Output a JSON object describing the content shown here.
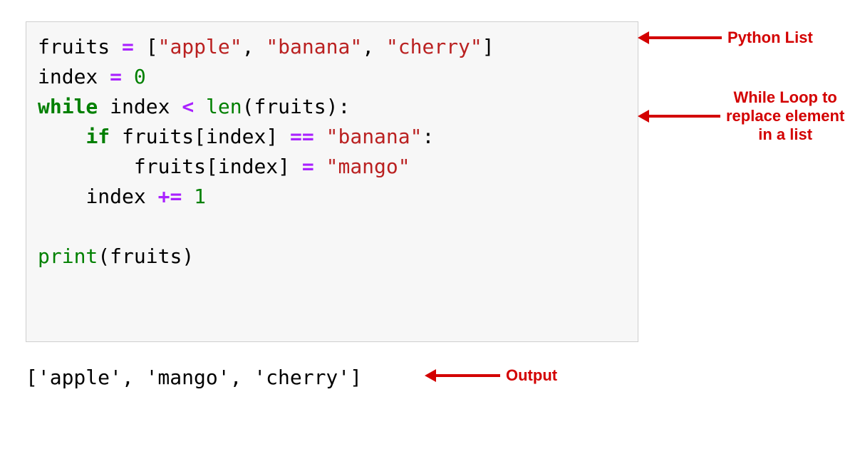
{
  "code": {
    "line1": {
      "var_fruits": "fruits",
      "assign": " = ",
      "lbracket": "[",
      "str_apple": "\"apple\"",
      "comma1": ", ",
      "str_banana": "\"banana\"",
      "comma2": ", ",
      "str_cherry": "\"cherry\"",
      "rbracket": "]"
    },
    "line2": {
      "var_index": "index",
      "assign": " = ",
      "num_zero": "0"
    },
    "line3": {
      "kw_while": "while",
      "sp1": " ",
      "var_index": "index",
      "sp2": " ",
      "op_lt": "<",
      "sp3": " ",
      "fn_len": "len",
      "lparen": "(",
      "var_fruits": "fruits",
      "rparen_colon": "):"
    },
    "line4": {
      "indent": "    ",
      "kw_if": "if",
      "sp1": " ",
      "var_fruits": "fruits",
      "lbracket": "[",
      "var_index": "index",
      "rbracket": "]",
      "sp2": " ",
      "op_eq": "==",
      "sp3": " ",
      "str_banana": "\"banana\"",
      "colon": ":"
    },
    "line5": {
      "indent": "        ",
      "var_fruits": "fruits",
      "lbracket": "[",
      "var_index": "index",
      "rbracket": "]",
      "sp1": " ",
      "op_assign": "=",
      "sp2": " ",
      "str_mango": "\"mango\""
    },
    "line6": {
      "indent": "    ",
      "var_index": "index",
      "sp1": " ",
      "op_pluseq": "+=",
      "sp2": " ",
      "num_one": "1"
    },
    "line7": "",
    "line8": {
      "fn_print": "print",
      "lparen": "(",
      "var_fruits": "fruits",
      "rparen": ")"
    }
  },
  "output": "['apple', 'mango', 'cherry']",
  "annotations": {
    "python_list": "Python List",
    "while_loop": "While Loop to\nreplace element\nin a list",
    "output_label": "Output"
  }
}
